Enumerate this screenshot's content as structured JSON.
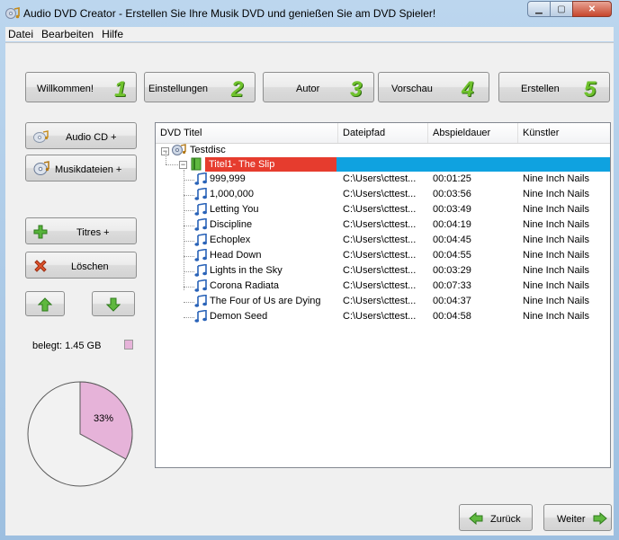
{
  "window": {
    "title": "Audio DVD Creator - Erstellen Sie Ihre Musik DVD und genießen Sie am DVD Spieler!"
  },
  "menu": [
    "Datei",
    "Bearbeiten",
    "Hilfe"
  ],
  "steps": [
    {
      "label": "Willkommen!",
      "num": "1"
    },
    {
      "label": "Einstellungen",
      "num": "2"
    },
    {
      "label": "Autor",
      "num": "3"
    },
    {
      "label": "Vorschau",
      "num": "4"
    },
    {
      "label": "Erstellen",
      "num": "5"
    }
  ],
  "side": {
    "audio_cd": "Audio CD +",
    "musikdateien": "Musikdateien +",
    "titres": "Titres +",
    "loeschen": "Löschen"
  },
  "columns": [
    "DVD Titel",
    "Dateipfad",
    "Abspieldauer",
    "Künstler"
  ],
  "tree": {
    "root": "Testdisc",
    "selected_title": "Titel1- The Slip",
    "tracks": [
      {
        "name": "999,999",
        "path": "C:\\Users\\cttest...",
        "duration": "00:01:25",
        "artist": "Nine Inch Nails"
      },
      {
        "name": "1,000,000",
        "path": "C:\\Users\\cttest...",
        "duration": "00:03:56",
        "artist": "Nine Inch Nails"
      },
      {
        "name": "Letting You",
        "path": "C:\\Users\\cttest...",
        "duration": "00:03:49",
        "artist": "Nine Inch Nails"
      },
      {
        "name": "Discipline",
        "path": "C:\\Users\\cttest...",
        "duration": "00:04:19",
        "artist": "Nine Inch Nails"
      },
      {
        "name": "Echoplex",
        "path": "C:\\Users\\cttest...",
        "duration": "00:04:45",
        "artist": "Nine Inch Nails"
      },
      {
        "name": "Head Down",
        "path": "C:\\Users\\cttest...",
        "duration": "00:04:55",
        "artist": "Nine Inch Nails"
      },
      {
        "name": "Lights in the Sky",
        "path": "C:\\Users\\cttest...",
        "duration": "00:03:29",
        "artist": "Nine Inch Nails"
      },
      {
        "name": "Corona Radiata",
        "path": "C:\\Users\\cttest...",
        "duration": "00:07:33",
        "artist": "Nine Inch Nails"
      },
      {
        "name": "The Four of Us are Dying",
        "path": "C:\\Users\\cttest...",
        "duration": "00:04:37",
        "artist": "Nine Inch Nails"
      },
      {
        "name": "Demon Seed",
        "path": "C:\\Users\\cttest...",
        "duration": "00:04:58",
        "artist": "Nine Inch Nails"
      }
    ]
  },
  "usage": {
    "label": "belegt: 1.45 GB",
    "percent_text": "33%",
    "fraction": 0.33,
    "used_color": "#e6b3d9",
    "free_color": "#f2f2f2"
  },
  "nav": {
    "back": "Zurück",
    "next": "Weiter"
  },
  "colors": {
    "selection_red": "#e63c2e",
    "selection_blue": "#0fa2e0",
    "step_green": "#6fc22c"
  }
}
